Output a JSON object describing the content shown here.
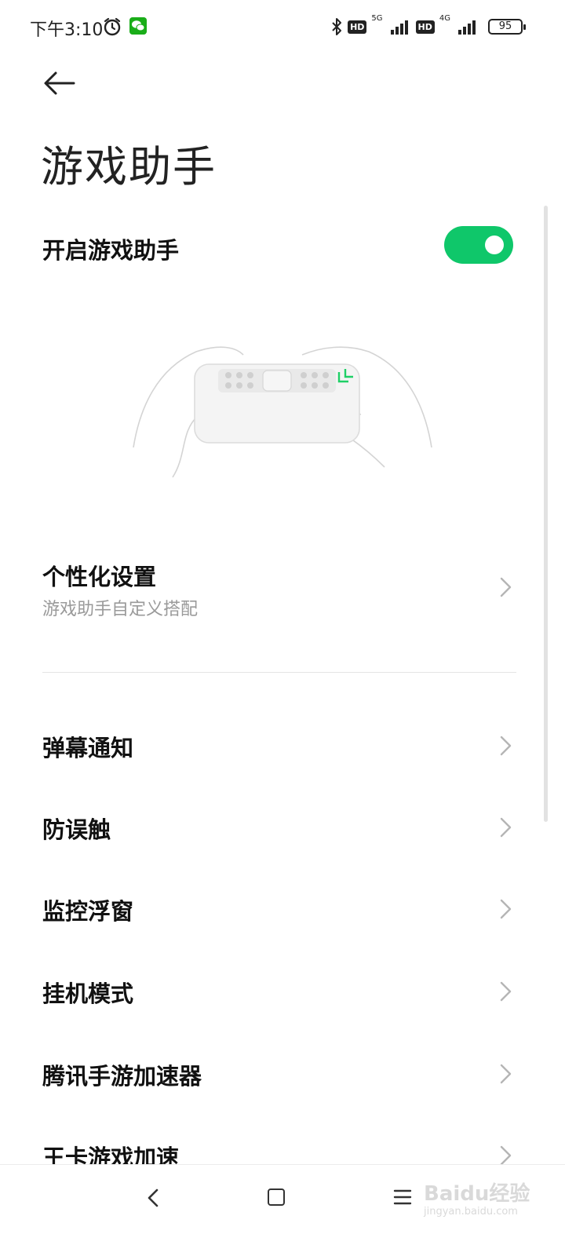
{
  "status_bar": {
    "time": "下午3:10",
    "network_badge_1": "HD",
    "network_label_1": "5G",
    "network_badge_2": "HD",
    "network_label_2": "4G",
    "battery": "95"
  },
  "page": {
    "title": "游戏助手"
  },
  "toggle": {
    "label": "开启游戏助手",
    "enabled": true,
    "color": "#0fc76a"
  },
  "settings": {
    "personalize": {
      "label": "个性化设置",
      "subtitle": "游戏助手自定义搭配"
    },
    "items": [
      {
        "label": "弹幕通知"
      },
      {
        "label": "防误触"
      },
      {
        "label": "监控浮窗"
      },
      {
        "label": "挂机模式"
      },
      {
        "label": "腾讯手游加速器"
      },
      {
        "label": "王卡游戏加速"
      }
    ]
  },
  "watermark": {
    "brand": "Baidu经验",
    "url": "jingyan.baidu.com"
  }
}
